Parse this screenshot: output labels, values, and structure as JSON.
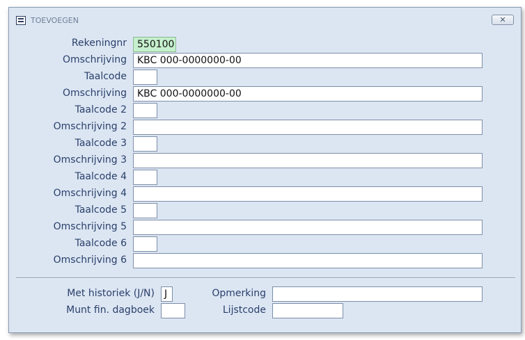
{
  "window": {
    "title": "TOEVOEGEN",
    "close_label": "✕"
  },
  "form": {
    "rekeningnr_label": "Rekeningnr",
    "rekeningnr_value": "550100",
    "omschrijving_label": "Omschrijving",
    "omschrijving_value": "KBC 000-0000000-00",
    "taalcode_label": "Taalcode",
    "taalcode_value": "",
    "omschrijving1_label": "Omschrijving",
    "omschrijving1_value": "KBC 000-0000000-00",
    "taalcode2_label": "Taalcode 2",
    "taalcode2_value": "",
    "omschrijving2_label": "Omschrijving 2",
    "omschrijving2_value": "",
    "taalcode3_label": "Taalcode 3",
    "taalcode3_value": "",
    "omschrijving3_label": "Omschrijving 3",
    "omschrijving3_value": "",
    "taalcode4_label": "Taalcode 4",
    "taalcode4_value": "",
    "omschrijving4_label": "Omschrijving 4",
    "omschrijving4_value": "",
    "taalcode5_label": "Taalcode 5",
    "taalcode5_value": "",
    "omschrijving5_label": "Omschrijving 5",
    "omschrijving5_value": "",
    "taalcode6_label": "Taalcode 6",
    "taalcode6_value": "",
    "omschrijving6_label": "Omschrijving 6",
    "omschrijving6_value": ""
  },
  "footer": {
    "historiek_label": "Met historiek (J/N)",
    "historiek_value": "J",
    "munt_label": "Munt fin. dagboek",
    "munt_value": "",
    "opmerking_label": "Opmerking",
    "opmerking_value": "",
    "lijstcode_label": "Lijstcode",
    "lijstcode_value": ""
  },
  "colors": {
    "window_bg": "#dce6f3",
    "label_text": "#2a3f6a",
    "highlight_field": "#c6efcd"
  }
}
